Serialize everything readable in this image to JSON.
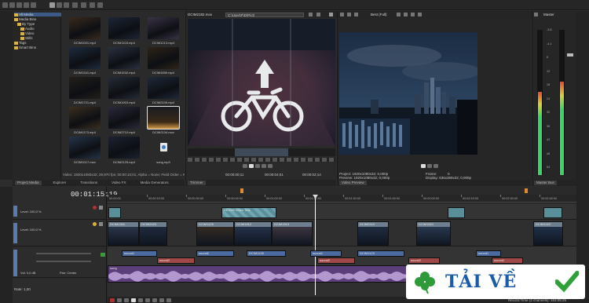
{
  "project_media": {
    "tree": [
      {
        "label": "All Media",
        "selected": true
      },
      {
        "label": "Media Bins",
        "selected": false
      },
      {
        "label": "By Type",
        "selected": false
      },
      {
        "label": "Audio",
        "selected": false
      },
      {
        "label": "Video",
        "selected": false
      },
      {
        "label": "Stills",
        "selected": false
      },
      {
        "label": "Tags",
        "selected": false
      },
      {
        "label": "Smart Bins",
        "selected": false
      }
    ],
    "thumbnails": [
      {
        "name": "DCIM1001.mp4",
        "color": "#3a2a1e"
      },
      {
        "name": "DCIM1103.mp4",
        "color": "#1d2636"
      },
      {
        "name": "DCIM1213.mp4",
        "color": "#3a3346"
      },
      {
        "name": "DCIM1341.mp4",
        "color": "#1e2c3e"
      },
      {
        "name": "DCIM1532.mp4",
        "color": "#2a3140"
      },
      {
        "name": "DCIM1659.mp4",
        "color": "#2e2418"
      },
      {
        "name": "DCIM1721.mp4",
        "color": "#24201a"
      },
      {
        "name": "DCIM1903.mp4",
        "color": "#262c36"
      },
      {
        "name": "DCIM2105.mp4",
        "color": "#1f2a3a"
      },
      {
        "name": "DCIM1173.mp4",
        "color": "#3c3020"
      },
      {
        "name": "DCIM2710.mp4",
        "color": "#2a2a3a"
      },
      {
        "name": "DCIM2134.mov",
        "color": "#1a1a22"
      },
      {
        "name": "DCIM1017.mov",
        "color": "#253448"
      },
      {
        "name": "DCIM2125.mp4",
        "color": "#1b2230"
      },
      {
        "name": "song.mp3",
        "color": "#3d3d3d"
      }
    ],
    "status_text": "Video: 1920x1080x32; 29,970 fps; 00:00:10;01; Alpha = None; Field Order = None"
  },
  "bottom_tabs_left": [
    "Project Media",
    "Explorer",
    "Transitions",
    "Video FX",
    "Media Generators"
  ],
  "trimmer": {
    "title": "DCIM2182.mov",
    "path": "C:\\User\\P\\D\\Pict\\",
    "timecode_in": "00:00:00;11",
    "timecode_out": "00:00:04;01",
    "timecode_len": "00:00:02;14",
    "tab": "Trimmer"
  },
  "preview": {
    "mode": "Best (Full)",
    "project_info": "Project:  1920x1080x32; 0,000p",
    "preview_info": "Preview: 1920x1080x32; 0,000p",
    "frame_label": "Frame:",
    "frame_value": "0",
    "display_info": "Display:  636x369x32; 0,000p",
    "tab": "Video Preview"
  },
  "master": {
    "title": "Master",
    "tab": "Master Bus",
    "scale": [
      "-3.8",
      "-4.1",
      "6",
      "12",
      "18",
      "24",
      "30",
      "36",
      "42",
      "48",
      "54"
    ],
    "left_level": 0.58,
    "right_level": 0.65
  },
  "timeline": {
    "timecode": "00:01:15:19",
    "ruler": [
      "00:00:00",
      "00:00:15:00",
      "00:00:30:00",
      "00:00:45:00",
      "00:01:00:00",
      "00:01:15:00",
      "00:01:30:00",
      "00:01:45:00",
      "00:02:00:00",
      "00:02:15:00",
      "00:02:30:00",
      "00:02:45:00"
    ],
    "tracks": [
      {
        "label": "Level: 100,0 %"
      },
      {
        "label": "Level: 100,0 %"
      },
      {
        "label": "Vol: 0,0 dB",
        "pan": "Pan: Center"
      }
    ],
    "title_clip": "VEGAS Video Text",
    "video_clips": [
      "DCIM1341",
      "DCIM2023",
      "DCIM1125",
      "DCIM1912",
      "DCIM1913",
      "DCIM2110",
      "DCIM1521",
      "DCIM1022"
    ],
    "audio_clips_1": [
      "sound1",
      "sound2",
      "DCIM1125",
      "sound1",
      "DCIM1123",
      "sound1"
    ],
    "audio_clips_2": [
      "sound2",
      "sound2",
      "sound2",
      "sound2"
    ],
    "music_clip": "song",
    "rate": "Rate: 1,00",
    "record_time": "Record Time (2 channels): 163:05:25"
  },
  "watermark": {
    "text": "TẢI VỀ"
  }
}
